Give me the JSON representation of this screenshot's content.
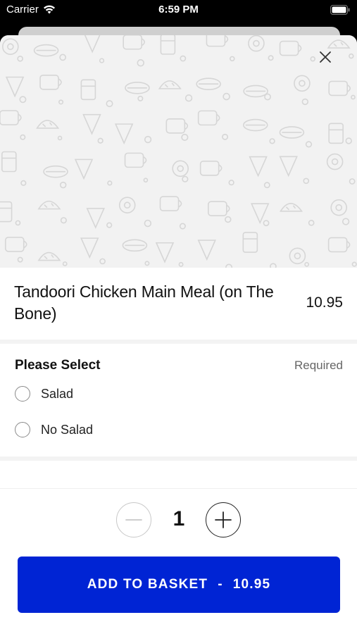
{
  "status_bar": {
    "carrier": "Carrier",
    "time": "6:59 PM"
  },
  "item": {
    "title": "Tandoori Chicken Main Meal (on The Bone)",
    "price": "10.95"
  },
  "options_section": {
    "title": "Please Select",
    "required_label": "Required",
    "options": [
      {
        "label": "Salad",
        "selected": false
      },
      {
        "label": "No Salad",
        "selected": false
      }
    ]
  },
  "quantity": {
    "value": "1"
  },
  "add_button": {
    "label": "ADD TO BASKET",
    "separator": "-",
    "price": "10.95"
  },
  "colors": {
    "accent": "#0024d4",
    "hero_bg": "#f2f2f2",
    "pattern_stroke": "#d6d6d6"
  }
}
